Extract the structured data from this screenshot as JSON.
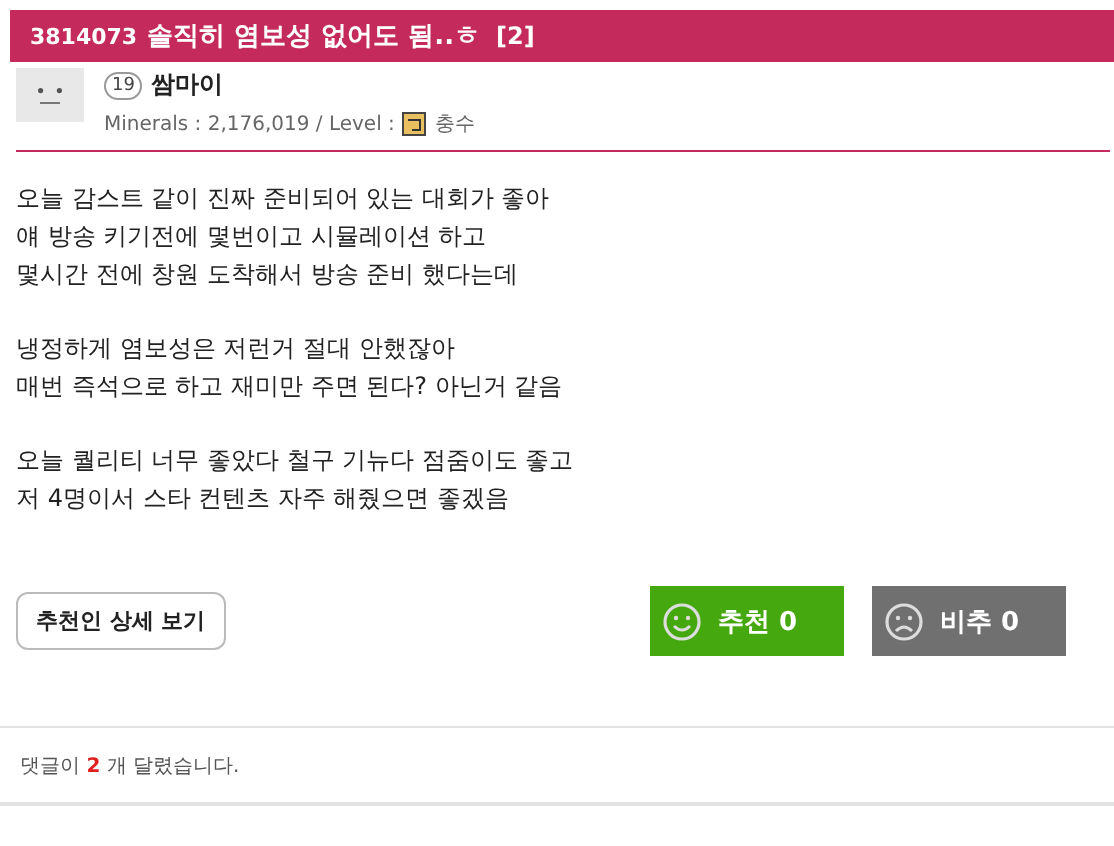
{
  "post": {
    "id": "3814073",
    "title": "솔직히 염보성 없어도 됨..ㅎ",
    "comment_count": "[2]"
  },
  "author": {
    "level": "19",
    "name": "쌈마이",
    "minerals_label": "Minerals : 2,176,019 / Level :",
    "rank": "충수"
  },
  "body": [
    [
      "오늘 감스트 같이 진짜 준비되어 있는 대회가 좋아",
      "얘 방송 키기전에 몇번이고 시뮬레이션 하고",
      "몇시간 전에 창원 도착해서 방송 준비 했다는데"
    ],
    [
      "냉정하게 염보성은 저런거 절대 안했잖아",
      "매번 즉석으로 하고 재미만 주면 된다? 아닌거 같음"
    ],
    [
      "오늘 퀄리티 너무 좋았다 철구 기뉴다 점줌이도 좋고",
      "저 4명이서 스타 컨텐츠 자주 해줬으면 좋겠음"
    ]
  ],
  "recommenders_button": "추천인 상세 보기",
  "votes": [
    {
      "kind": "up",
      "label": "추천 0"
    },
    {
      "kind": "down",
      "label": "비추 0"
    }
  ],
  "comments": {
    "prefix": "댓글이",
    "count": "2",
    "suffix": "개 달렸습니다."
  }
}
